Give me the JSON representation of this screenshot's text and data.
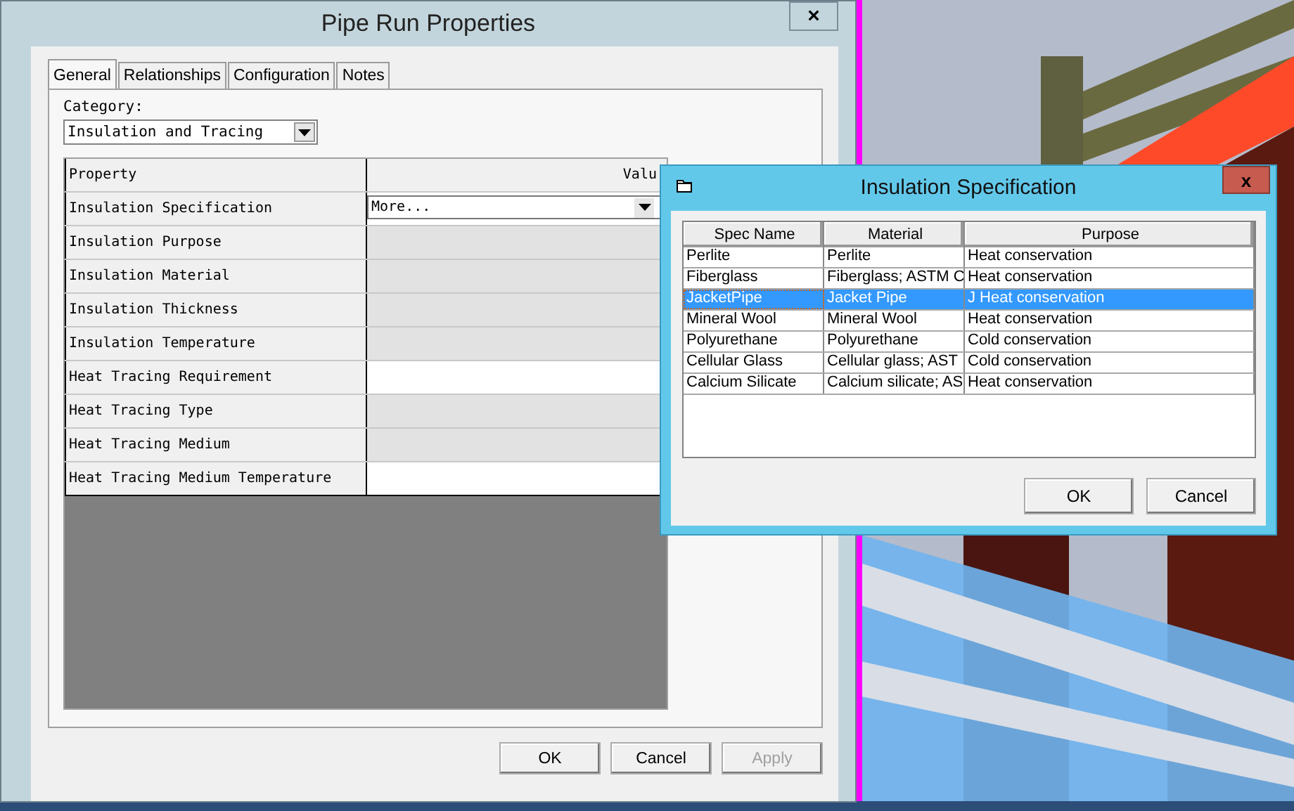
{
  "main_dialog": {
    "title": "Pipe Run Properties",
    "close": "×",
    "tabs": [
      {
        "label": "General",
        "selected": true
      },
      {
        "label": "Relationships",
        "selected": false
      },
      {
        "label": "Configuration",
        "selected": false
      },
      {
        "label": "Notes",
        "selected": false
      }
    ],
    "category": {
      "label": "Category:",
      "value": "Insulation and Tracing"
    },
    "grid": {
      "columns": [
        "Property",
        "Valu"
      ],
      "rows": [
        {
          "property": "Insulation Specification",
          "value": "More...",
          "editable": true,
          "kind": "dropdown"
        },
        {
          "property": "Insulation Purpose",
          "editable": false,
          "kind": "text"
        },
        {
          "property": "Insulation Material",
          "editable": false,
          "kind": "text"
        },
        {
          "property": "Insulation Thickness",
          "editable": false,
          "kind": "text"
        },
        {
          "property": "Insulation Temperature",
          "editable": false,
          "kind": "text"
        },
        {
          "property": "Heat Tracing Requirement",
          "editable": true,
          "kind": "text"
        },
        {
          "property": "Heat Tracing Type",
          "editable": false,
          "kind": "text"
        },
        {
          "property": "Heat Tracing Medium",
          "editable": false,
          "kind": "text"
        },
        {
          "property": "Heat Tracing Medium Temperature",
          "editable": true,
          "kind": "text"
        }
      ]
    },
    "buttons": [
      {
        "label": "OK",
        "disabled": false
      },
      {
        "label": "Cancel",
        "disabled": false
      },
      {
        "label": "Apply",
        "disabled": true
      }
    ]
  },
  "spec_dialog": {
    "title": "Insulation Specification",
    "close": "x",
    "columns": [
      "Spec Name",
      "Material",
      "Purpose"
    ],
    "rows": [
      {
        "spec_name": "Perlite",
        "material": "Perlite",
        "purpose": "Heat conservation",
        "selected": false
      },
      {
        "spec_name": "Fiberglass",
        "material": "Fiberglass; ASTM C",
        "purpose": "Heat conservation",
        "selected": false
      },
      {
        "spec_name": "JacketPipe",
        "material": "Jacket Pipe",
        "purpose": "J Heat conservation",
        "selected": true
      },
      {
        "spec_name": "Mineral Wool",
        "material": "Mineral Wool",
        "purpose": "Heat conservation",
        "selected": false
      },
      {
        "spec_name": "Polyurethane",
        "material": "Polyurethane",
        "purpose": "Cold conservation",
        "selected": false
      },
      {
        "spec_name": "Cellular Glass",
        "material": "Cellular glass; AST",
        "purpose": "Cold conservation",
        "selected": false
      },
      {
        "spec_name": "Calcium Silicate",
        "material": "Calcium silicate; AS",
        "purpose": "Heat conservation",
        "selected": false
      }
    ],
    "buttons": [
      "OK",
      "Cancel"
    ]
  }
}
